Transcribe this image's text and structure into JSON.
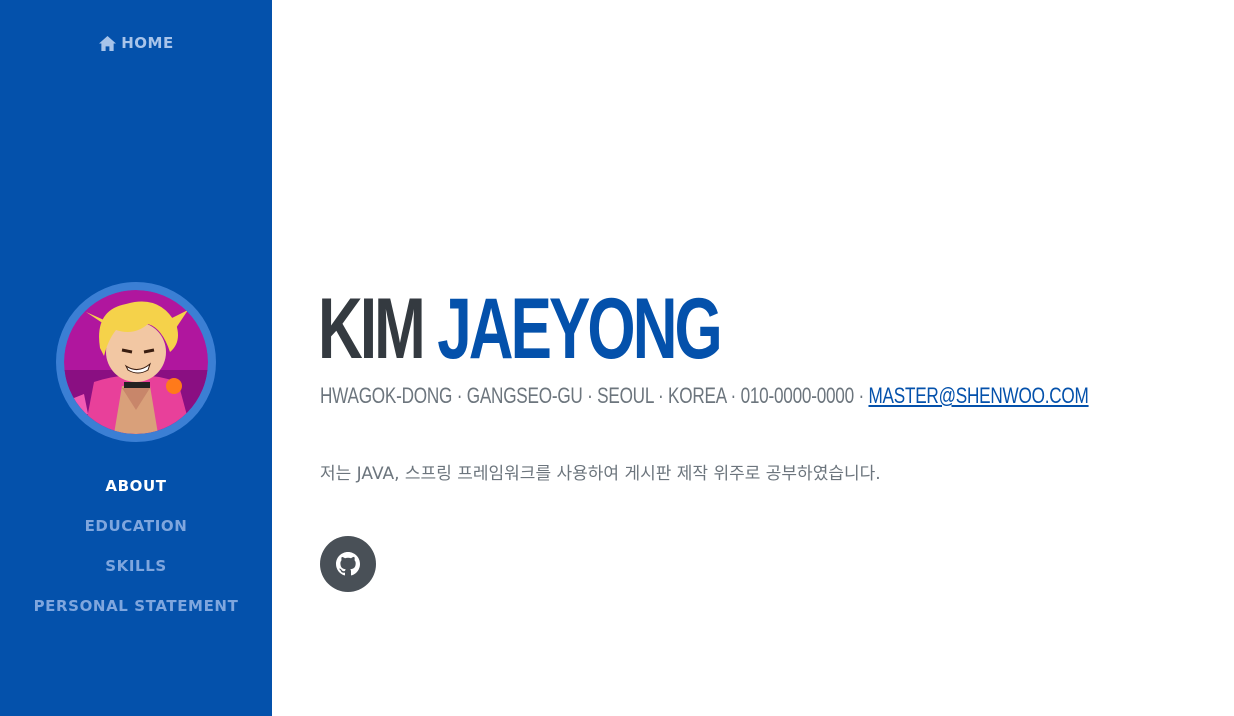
{
  "sidebar": {
    "home_label": "HOME",
    "home_icon": "home-icon",
    "bg_color": "#0451ab",
    "nav_items": [
      {
        "label": "ABOUT",
        "active": true
      },
      {
        "label": "EDUCATION",
        "active": false
      },
      {
        "label": "SKILLS",
        "active": false
      },
      {
        "label": "PERSONAL STATEMENT",
        "active": false
      }
    ]
  },
  "profile": {
    "first_name": "KIM",
    "last_name": "JAEYONG",
    "address": "HWAGOK-DONG · GANGSEO-GU · SEOUL · KOREA · 010-0000-0000 · ",
    "email": "MASTER@SHENWOO.COM",
    "intro": "저는 JAVA, 스프링 프레임워크를 사용하여 게시판 제작 위주로 공부하였습니다.",
    "social_icon": "github-icon"
  },
  "colors": {
    "accent": "#0451ab",
    "name_dark": "#343a40",
    "muted": "#6c757d",
    "social_bg": "#495057"
  }
}
